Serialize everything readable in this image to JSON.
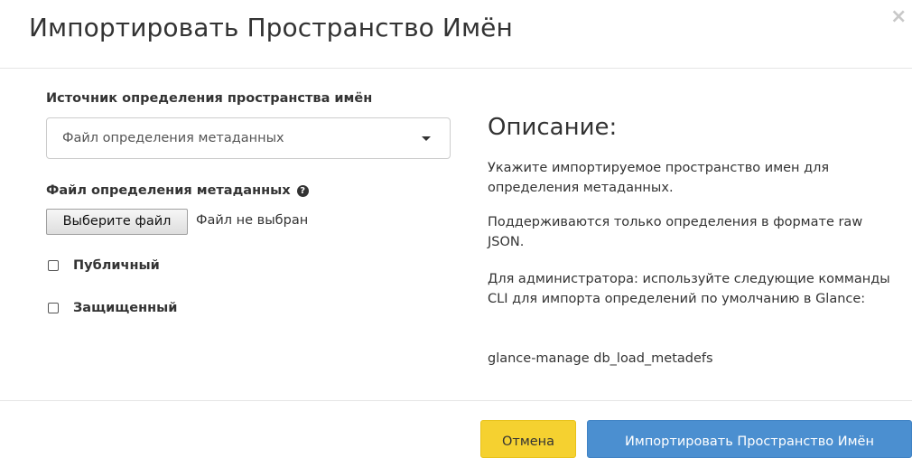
{
  "dialog": {
    "title": "Импортировать Пространство Имён",
    "close_icon": "×"
  },
  "form": {
    "source_label": "Источник определения пространства имён",
    "source_select_value": "Файл определения метаданных",
    "file_label": "Файл определения метаданных",
    "file_help_icon": "?",
    "file_button_label": "Выберите файл",
    "file_status": "Файл не выбран",
    "public_label": "Публичный",
    "public_checked": false,
    "protected_label": "Защищенный",
    "protected_checked": false
  },
  "description": {
    "title": "Описание:",
    "p1": "Укажите импортируемое пространство имен для определения метаданных.",
    "p2": "Поддерживаются только определения в формате raw JSON.",
    "p3": "Для администратора: используйте следующие комманды CLI для импорта определений по умолчанию в Glance:",
    "p4": "glance-manage db_load_metadefs"
  },
  "footer": {
    "cancel_label": "Отмена",
    "import_label": "Импортировать Пространство Имён"
  },
  "colors": {
    "cancel_button": "#f5d130",
    "import_button": "#4b8fd0"
  }
}
